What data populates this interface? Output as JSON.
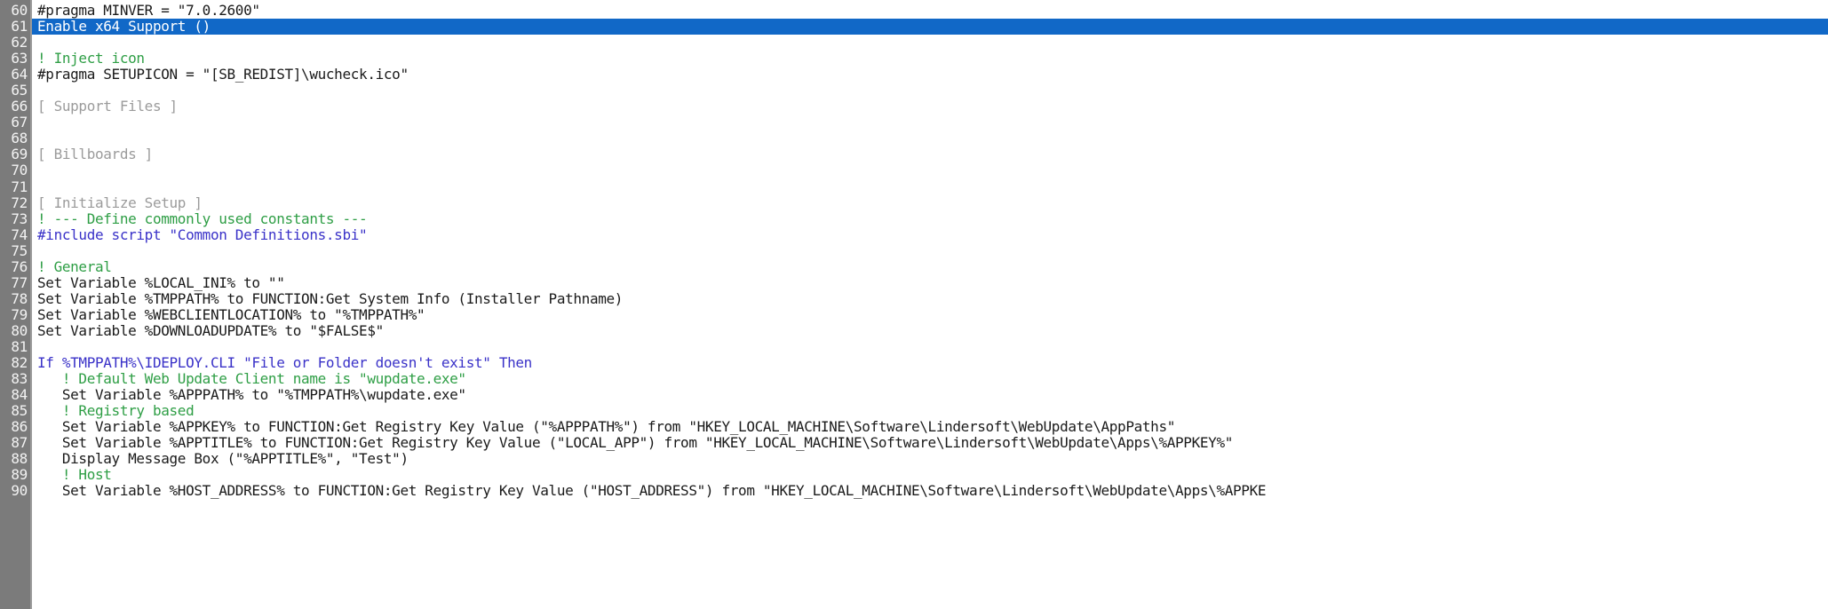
{
  "editor": {
    "name": "script-code-editor",
    "language": "SetupBuilder Script (.sbi)",
    "first_visible_line": 60,
    "last_visible_line": 90,
    "selected_line": 61,
    "selection_color": "#1168c7",
    "gutter_background": "#7b7b7b",
    "gutter_text_color": "#f2f2f2",
    "background": "#ffffff",
    "colors": {
      "plain": "#1a1a1a",
      "comment": "#2e9e45",
      "section": "#9b9b9b",
      "preprocessor": "#3a32c8",
      "keyword": "#3a32c8"
    }
  },
  "lines": [
    {
      "num": "60",
      "selected": false,
      "tokens": [
        {
          "c": "plain",
          "t": "#pragma MINVER = \"7.0.2600\""
        }
      ]
    },
    {
      "num": "61",
      "selected": true,
      "tokens": [
        {
          "c": "plain",
          "t": "Enable x64 Support ()"
        }
      ]
    },
    {
      "num": "62",
      "selected": false,
      "tokens": [
        {
          "c": "plain",
          "t": ""
        }
      ]
    },
    {
      "num": "63",
      "selected": false,
      "tokens": [
        {
          "c": "comment",
          "t": "! Inject icon"
        }
      ]
    },
    {
      "num": "64",
      "selected": false,
      "tokens": [
        {
          "c": "plain",
          "t": "#pragma SETUPICON = \"[SB_REDIST]\\wucheck.ico\""
        }
      ]
    },
    {
      "num": "65",
      "selected": false,
      "tokens": [
        {
          "c": "plain",
          "t": ""
        }
      ]
    },
    {
      "num": "66",
      "selected": false,
      "tokens": [
        {
          "c": "section",
          "t": "[ Support Files ]"
        }
      ]
    },
    {
      "num": "67",
      "selected": false,
      "tokens": [
        {
          "c": "plain",
          "t": ""
        }
      ]
    },
    {
      "num": "68",
      "selected": false,
      "tokens": [
        {
          "c": "plain",
          "t": ""
        }
      ]
    },
    {
      "num": "69",
      "selected": false,
      "tokens": [
        {
          "c": "section",
          "t": "[ Billboards ]"
        }
      ]
    },
    {
      "num": "70",
      "selected": false,
      "tokens": [
        {
          "c": "plain",
          "t": ""
        }
      ]
    },
    {
      "num": "71",
      "selected": false,
      "tokens": [
        {
          "c": "plain",
          "t": ""
        }
      ]
    },
    {
      "num": "72",
      "selected": false,
      "tokens": [
        {
          "c": "section",
          "t": "[ Initialize Setup ]"
        }
      ]
    },
    {
      "num": "73",
      "selected": false,
      "tokens": [
        {
          "c": "comment",
          "t": "! --- Define commonly used constants ---"
        }
      ]
    },
    {
      "num": "74",
      "selected": false,
      "tokens": [
        {
          "c": "pre",
          "t": "#include script \"Common Definitions.sbi\""
        }
      ]
    },
    {
      "num": "75",
      "selected": false,
      "tokens": [
        {
          "c": "plain",
          "t": ""
        }
      ]
    },
    {
      "num": "76",
      "selected": false,
      "tokens": [
        {
          "c": "comment",
          "t": "! General"
        }
      ]
    },
    {
      "num": "77",
      "selected": false,
      "tokens": [
        {
          "c": "plain",
          "t": "Set Variable %LOCAL_INI% to \"\""
        }
      ]
    },
    {
      "num": "78",
      "selected": false,
      "tokens": [
        {
          "c": "plain",
          "t": "Set Variable %TMPPATH% to FUNCTION:Get System Info (Installer Pathname)"
        }
      ]
    },
    {
      "num": "79",
      "selected": false,
      "tokens": [
        {
          "c": "plain",
          "t": "Set Variable %WEBCLIENTLOCATION% to \"%TMPPATH%\""
        }
      ]
    },
    {
      "num": "80",
      "selected": false,
      "tokens": [
        {
          "c": "plain",
          "t": "Set Variable %DOWNLOADUPDATE% to \"$FALSE$\""
        }
      ]
    },
    {
      "num": "81",
      "selected": false,
      "tokens": [
        {
          "c": "plain",
          "t": ""
        }
      ]
    },
    {
      "num": "82",
      "selected": false,
      "tokens": [
        {
          "c": "kw",
          "t": "If %TMPPATH%\\IDEPLOY.CLI \"File or Folder doesn't exist\" Then"
        }
      ]
    },
    {
      "num": "83",
      "selected": false,
      "tokens": [
        {
          "c": "comment",
          "t": "   ! Default Web Update Client name is \"wupdate.exe\""
        }
      ]
    },
    {
      "num": "84",
      "selected": false,
      "tokens": [
        {
          "c": "plain",
          "t": "   Set Variable %APPPATH% to \"%TMPPATH%\\wupdate.exe\""
        }
      ]
    },
    {
      "num": "85",
      "selected": false,
      "tokens": [
        {
          "c": "comment",
          "t": "   ! Registry based"
        }
      ]
    },
    {
      "num": "86",
      "selected": false,
      "tokens": [
        {
          "c": "plain",
          "t": "   Set Variable %APPKEY% to FUNCTION:Get Registry Key Value (\"%APPPATH%\") from \"HKEY_LOCAL_MACHINE\\Software\\Lindersoft\\WebUpdate\\AppPaths\""
        }
      ]
    },
    {
      "num": "87",
      "selected": false,
      "tokens": [
        {
          "c": "plain",
          "t": "   Set Variable %APPTITLE% to FUNCTION:Get Registry Key Value (\"LOCAL_APP\") from \"HKEY_LOCAL_MACHINE\\Software\\Lindersoft\\WebUpdate\\Apps\\%APPKEY%\""
        }
      ]
    },
    {
      "num": "88",
      "selected": false,
      "tokens": [
        {
          "c": "plain",
          "t": "   Display Message Box (\"%APPTITLE%\", \"Test\")"
        }
      ]
    },
    {
      "num": "89",
      "selected": false,
      "tokens": [
        {
          "c": "comment",
          "t": "   ! Host"
        }
      ]
    },
    {
      "num": "90",
      "selected": false,
      "tokens": [
        {
          "c": "plain",
          "t": "   Set Variable %HOST_ADDRESS% to FUNCTION:Get Registry Key Value (\"HOST_ADDRESS\") from \"HKEY_LOCAL_MACHINE\\Software\\Lindersoft\\WebUpdate\\Apps\\%APPKE"
        }
      ]
    }
  ]
}
